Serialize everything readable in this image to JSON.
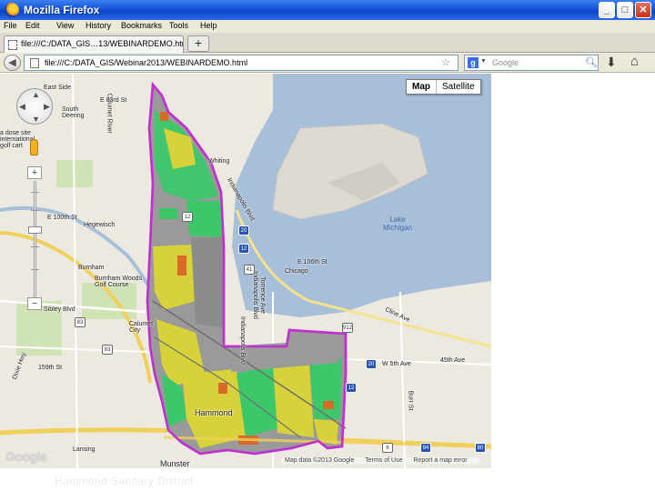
{
  "window": {
    "title": "Mozilla Firefox",
    "controls": {
      "minimize": "_",
      "maximize": "□",
      "close": "✕"
    }
  },
  "menubar": {
    "items": [
      "File",
      "Edit",
      "View",
      "History",
      "Bookmarks",
      "Tools",
      "Help"
    ]
  },
  "tabs": [
    {
      "label": "file:///C:/DATA_GIS…13/WEBINARDEMO.html"
    }
  ],
  "newtab": {
    "label": "+"
  },
  "navbar": {
    "url": "file:///C:/DATA_GIS/Webinar2013/WEBINARDEMO.html",
    "search_placeholder": "Google",
    "search_engine_icon": "g"
  },
  "map": {
    "type_buttons": {
      "map": "Map",
      "satellite": "Satellite"
    },
    "labels": {
      "l1": "East Side",
      "l2": "South Deering",
      "l3": "E 100th St",
      "l4": "Hegewisch",
      "l5": "Burnham",
      "l6": "Burnham Woods Golf Course",
      "l7": "Sibley Blvd",
      "l8": "Calumet City",
      "l9": "Whiting",
      "l10": "Chicago",
      "l11": "Indianapolis Blvd",
      "l12": "Indianapolis Blvd",
      "l13": "Hammond",
      "l14": "Lansing",
      "l15": "Munster",
      "l16": "W 5th Ave",
      "l17": "45th Ave",
      "l18": "E 106th St",
      "l19": "Calumet River",
      "l20": "Cline Ave",
      "l21": "Indianapolis Blvd",
      "l22": "Torrence Ave",
      "l23": "159th St",
      "l24": "Dixie Hwy",
      "l25": "Burr St",
      "l26": "E 83rd St",
      "l27": "a dose site international golf cart"
    },
    "water": {
      "lake": "Lake Michigan"
    },
    "shields": {
      "s1": "20",
      "s2": "12",
      "s3": "12",
      "s4": "41",
      "s5": "83",
      "s6": "83",
      "s7": "912",
      "s8": "20",
      "s9": "12",
      "s10": "6",
      "s11": "94",
      "s12": "80"
    },
    "attribution": {
      "data": "Map data ©2013 Google",
      "terms": "Terms of Use",
      "report": "Report a map error"
    },
    "logo": "Google"
  },
  "footer": {
    "caption": "Hammond Sanitary District"
  },
  "colors": {
    "district_outline": "#c030d0",
    "zone_gray": "#9a9a9a",
    "zone_green": "#3cc76a",
    "zone_yellow": "#d8d23a",
    "zone_orange": "#d86a28",
    "water": "#a7bfd9",
    "land": "#ece9e0"
  }
}
